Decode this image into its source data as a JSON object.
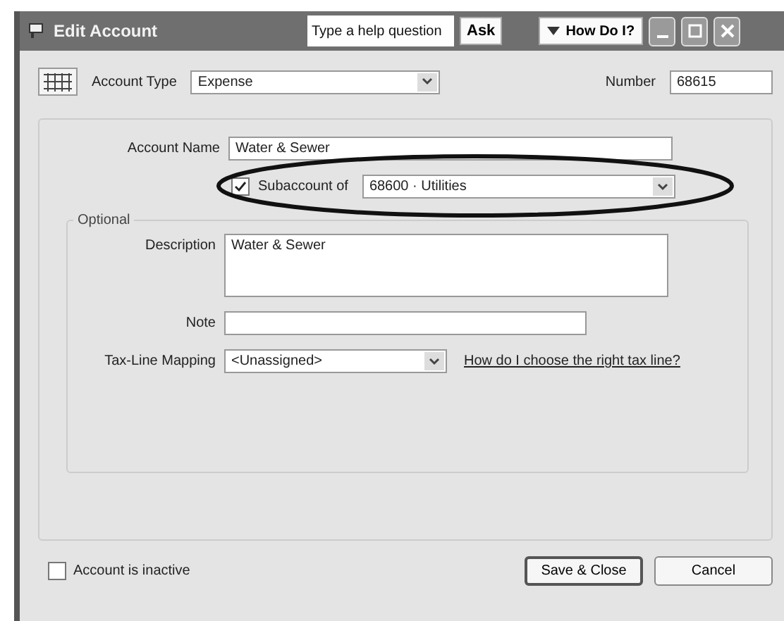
{
  "window": {
    "title": "Edit Account",
    "help_placeholder": "Type a help question",
    "ask_button": "Ask",
    "how_do_i_button": "How Do I?"
  },
  "account_type": {
    "label": "Account Type",
    "value": "Expense"
  },
  "number": {
    "label": "Number",
    "value": "68615"
  },
  "account_name": {
    "label": "Account Name",
    "value": "Water & Sewer"
  },
  "subaccount": {
    "label": "Subaccount of",
    "checked": true,
    "value": "68600 · Utilities",
    "highlighted": true
  },
  "optional": {
    "legend": "Optional",
    "description": {
      "label": "Description",
      "value": "Water & Sewer"
    },
    "note": {
      "label": "Note"
    },
    "tax_line": {
      "label": "Tax-Line Mapping",
      "value": "<Unassigned>",
      "link": "How do I choose the right tax line?"
    }
  },
  "inactive": {
    "label": "Account is inactive",
    "checked": false
  },
  "buttons": [
    {
      "label": "Save & Close",
      "default": true
    },
    {
      "label": "Cancel",
      "default": false
    }
  ]
}
